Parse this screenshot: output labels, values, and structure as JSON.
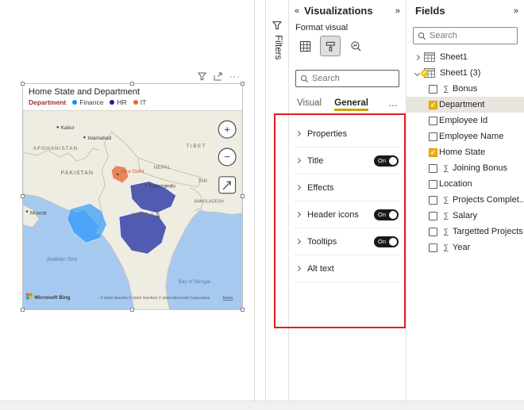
{
  "icons": {
    "collapse": "«",
    "expand": "»",
    "more": "⋯",
    "toolbar_more": "···"
  },
  "colors": {
    "accent_yellow": "#F2C811",
    "tab_underline": "#C9A109",
    "highlight_red": "#E31B23",
    "toggle_on": "#1A1A1A",
    "selected_row": "#E8E6DF"
  },
  "canvas": {
    "visual": {
      "title": "Home State and Department",
      "legend": {
        "title": "Department",
        "title_color": "#9E2F2F",
        "items": [
          {
            "label": "Finance",
            "color": "#118DFF"
          },
          {
            "label": "HR",
            "color": "#12239E"
          },
          {
            "label": "IT",
            "color": "#E66C37"
          }
        ]
      },
      "map": {
        "colors": {
          "sea": "#A6C9F0",
          "land": "#EFECE2"
        },
        "zoom_in": "+",
        "zoom_out": "−",
        "labels": {
          "kabul": "Kabul",
          "afghanistan": "AFGHANISTAN",
          "islamabad": "Islamabad",
          "tibet": "TIBET",
          "pakistan": "PAKISTAN",
          "new_delhi": "New Delhi",
          "nepal": "NEPAL",
          "kathmandu": "Kathmandu",
          "bhutan": "TAN",
          "bangladesh": "BANGLADESH",
          "india": "INDIA",
          "muscat": "Muscat",
          "arabian_sea": "Arabian Sea",
          "bay_of_bengal": "Bay of Bengal"
        },
        "attribution": {
          "bing": "Microsoft Bing",
          "copyright": "© 2022 NavInfo  © 2022 TomTom  © 2022 Microsoft Corporation",
          "terms": "Terms"
        }
      }
    }
  },
  "filters_pane": {
    "title": "Filters"
  },
  "visualizations_pane": {
    "title": "Visualizations",
    "subtitle": "Format visual",
    "search_placeholder": "Search",
    "tabs": [
      {
        "label": "Visual",
        "active": false
      },
      {
        "label": "General",
        "active": true
      }
    ],
    "sections": [
      {
        "label": "Properties",
        "toggle": null
      },
      {
        "label": "Title",
        "toggle": "On"
      },
      {
        "label": "Effects",
        "toggle": null
      },
      {
        "label": "Header icons",
        "toggle": "On"
      },
      {
        "label": "Tooltips",
        "toggle": "On"
      },
      {
        "label": "Alt text",
        "toggle": null
      }
    ]
  },
  "fields_pane": {
    "title": "Fields",
    "search_placeholder": "Search",
    "sigma_glyph": "∑",
    "tables": [
      {
        "name": "Sheet1",
        "expanded": false,
        "checked": false
      },
      {
        "name": "Sheet1 (3)",
        "expanded": true,
        "checked": true
      }
    ],
    "fields": [
      {
        "label": "Bonus",
        "sigma": true,
        "checked": false
      },
      {
        "label": "Department",
        "sigma": false,
        "checked": true,
        "selected": true
      },
      {
        "label": "Employee Id",
        "sigma": false,
        "checked": false
      },
      {
        "label": "Employee Name",
        "sigma": false,
        "checked": false
      },
      {
        "label": "Home State",
        "sigma": false,
        "checked": true
      },
      {
        "label": "Joining Bonus",
        "sigma": true,
        "checked": false
      },
      {
        "label": "Location",
        "sigma": false,
        "checked": false
      },
      {
        "label": "Projects Complet...",
        "sigma": true,
        "checked": false
      },
      {
        "label": "Salary",
        "sigma": true,
        "checked": false
      },
      {
        "label": "Targetted Projects",
        "sigma": true,
        "checked": false
      },
      {
        "label": "Year",
        "sigma": true,
        "checked": false
      }
    ]
  }
}
